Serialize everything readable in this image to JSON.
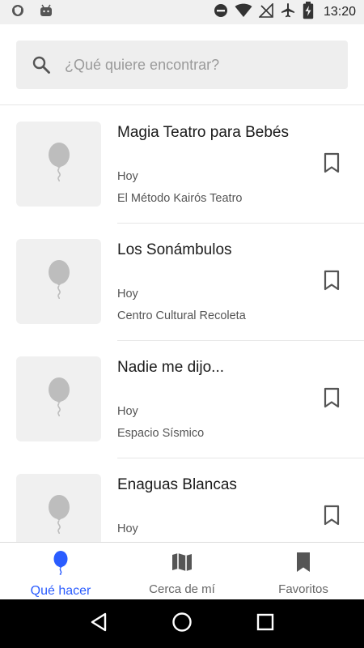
{
  "status_bar": {
    "time": "13:20",
    "icons": [
      "shield-icon",
      "android-icon",
      "do-not-disturb-icon",
      "wifi-icon",
      "no-signal-icon",
      "airplane-icon",
      "battery-charging-icon"
    ]
  },
  "search": {
    "placeholder": "¿Qué quiere encontrar?"
  },
  "events": [
    {
      "title": "Magia Teatro para Bebés",
      "date": "Hoy",
      "venue": "El Método Kairós Teatro"
    },
    {
      "title": "Los Sonámbulos",
      "date": "Hoy",
      "venue": "Centro Cultural Recoleta"
    },
    {
      "title": "Nadie me dijo...",
      "date": "Hoy",
      "venue": "Espacio Sísmico"
    },
    {
      "title": "Enaguas Blancas",
      "date": "Hoy",
      "venue": ""
    }
  ],
  "bottom_nav": {
    "items": [
      {
        "label": "Qué hacer",
        "icon": "balloon-icon",
        "active": true
      },
      {
        "label": "Cerca de mí",
        "icon": "map-icon",
        "active": false
      },
      {
        "label": "Favoritos",
        "icon": "bookmark-icon",
        "active": false
      }
    ]
  },
  "colors": {
    "accent": "#2a5cff",
    "placeholder_gray": "#bdbdbd",
    "icon_gray": "#555555"
  }
}
